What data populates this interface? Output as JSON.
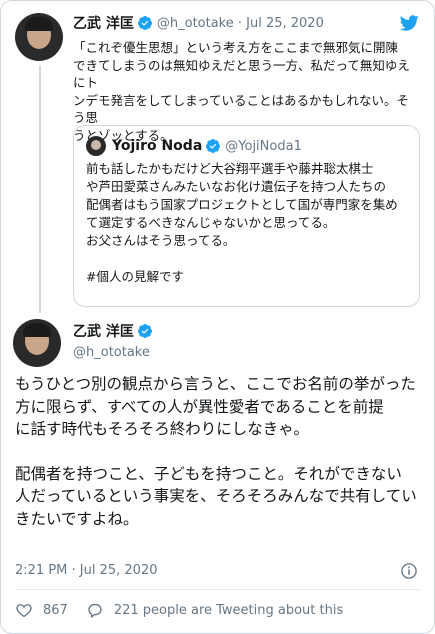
{
  "colors": {
    "accent": "#1da1f2",
    "muted": "#657786",
    "border": "#cfd9de"
  },
  "parent_tweet": {
    "name": "乙武 洋匡",
    "handle_date": "@h_ototake · Jul 25, 2020",
    "lines": [
      "「これぞ優生思想」という考え方をここまで無邪気に開陳",
      "できてしまうのは無知ゆえだと思う一方、私だって無知ゆえにト",
      "ンデモ発言をしてしまっていることはあるかもしれない。そう思",
      "うとゾッとする。"
    ],
    "icon": "twitter-bird-icon"
  },
  "quote_tweet": {
    "name": "Yojiro Noda",
    "handle": "@YojiNoda1",
    "lines": [
      "前も話したかもだけど大谷翔平選手や藤井聡太棋士",
      "や芦田愛菜さんみたいなお化け遺伝子を持つ人たちの",
      "配偶者はもう国家プロジェクトとして国が専門家を集め",
      "て選定するべきなんじゃないかと思ってる。",
      "お父さんはそう思ってる。",
      "",
      "#個人の見解です"
    ]
  },
  "main_tweet": {
    "name": "乙武 洋匡",
    "handle": "@h_ototake",
    "paragraph1": [
      "もうひとつ別の観点から言うと、ここでお名前の挙がった",
      "方に限らず、すべての人が異性愛者であることを前提",
      "に話す時代もそろそろ終わりにしなきゃ。"
    ],
    "paragraph2": [
      "配偶者を持つこと、子どもを持つこと。それができない",
      "人だっているという事実を、そろそろみんなで共有してい",
      "きたいですよね。"
    ],
    "timestamp": "2:21 PM · Jul 25, 2020",
    "likes": "867",
    "people_tweeting": "221 people are Tweeting about this"
  }
}
